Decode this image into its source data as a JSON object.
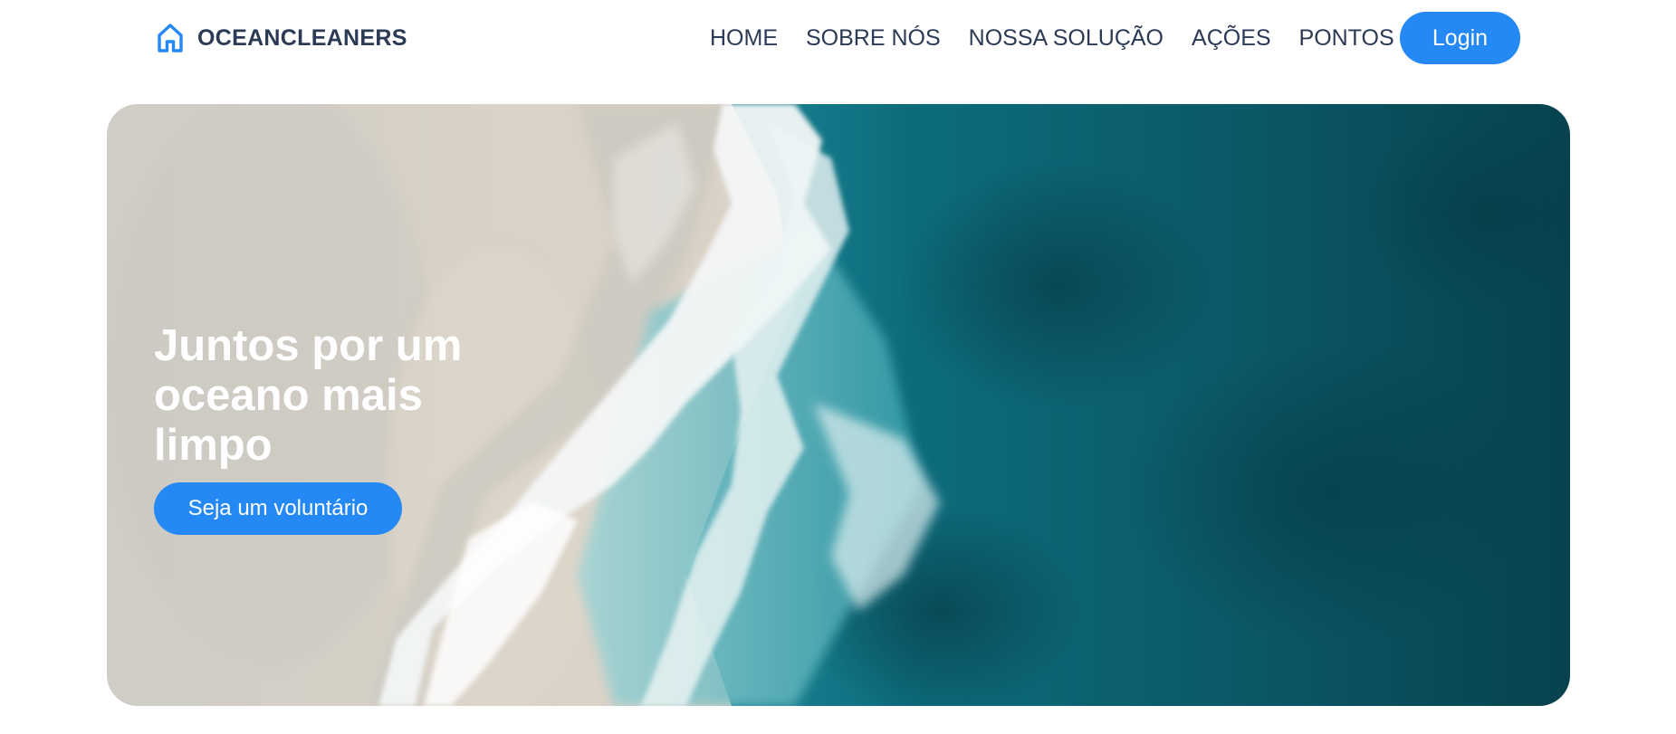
{
  "brand": {
    "name": "OCEANCLEANERS",
    "icon": "home-icon",
    "color": "#2589f5"
  },
  "nav": {
    "links": [
      {
        "label": "HOME"
      },
      {
        "label": "SOBRE NÓS"
      },
      {
        "label": "NOSSA SOLUÇÃO"
      },
      {
        "label": "AÇÕES"
      },
      {
        "label": "PONTOS"
      }
    ],
    "login_label": "Login"
  },
  "hero": {
    "title": "Juntos por um oceano mais limpo",
    "cta_label": "Seja um voluntário",
    "background": "aerial-beach-ocean-image"
  },
  "colors": {
    "accent": "#2589f5",
    "text": "#2b3a55",
    "sand": "#d8d2c6",
    "ocean_deep": "#0b4d5c"
  }
}
